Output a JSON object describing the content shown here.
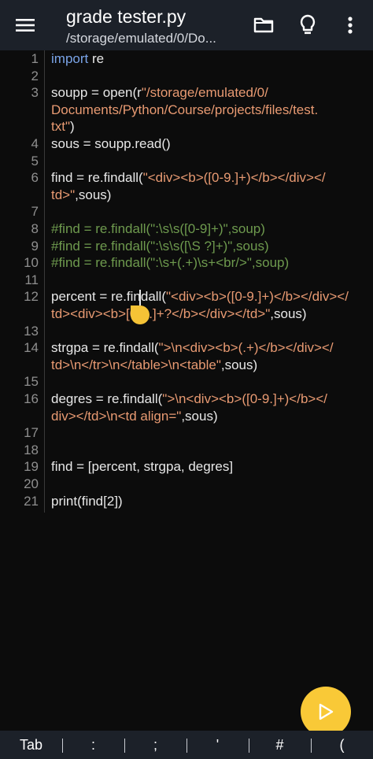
{
  "header": {
    "title": "grade tester.py",
    "path": "/storage/emulated/0/Do..."
  },
  "icons": {
    "menu": "hamburger-menu-icon",
    "folder": "folder-icon",
    "bulb": "lightbulb-icon",
    "more": "more-vert-icon",
    "run": "play-icon"
  },
  "colors": {
    "keyword": "#7aa4e8",
    "string": "#e89a72",
    "comment": "#6e9a4e",
    "accent": "#f9c937",
    "bar": "#1c2129"
  },
  "line_numbers": [
    "1",
    "2",
    "3",
    "4",
    "5",
    "6",
    "7",
    "8",
    "9",
    "10",
    "11",
    "12",
    "13",
    "14",
    "15",
    "16",
    "17",
    "18",
    "19",
    "20",
    "21"
  ],
  "code": {
    "l1_kw": "import",
    "l1_rest": " re",
    "l3_a": "soupp = open(r",
    "l3_b": "\"/storage/emulated/0/",
    "l3w1": "Documents/Python/Course/projects/files/test.",
    "l3w2_s": "txt\"",
    "l3w2_p": ")",
    "l4": "sous = soupp.read()",
    "l6_a": "find = re.findall(",
    "l6_b": "\"<div><b>([0-9.]+)</b></div></",
    "l6w_s": "td>\"",
    "l6w_p": ",sous)",
    "l8": "#find = re.findall(\":\\s\\s([0-9]+)\",soup)",
    "l9": "#find = re.findall(\":\\s\\s([\\S ?]+)\",sous)",
    "l10": "#find = re.findall(\":\\s+(.+)\\s+<br/>\",soup)",
    "l12_a": "percent = re.findall(",
    "l12_b": "\"<div><b>([0-9.]+)</b></div></",
    "l12w_s": "td><div><b>[0-9.]+?</b></div></td>\"",
    "l12w_p": ",sous)",
    "l14_a": "strgpa = re.findall(",
    "l14_b": "\">\\n<div><b>(.+)</b></div></",
    "l14w_s": "td>\\n</tr>\\n</table>\\n<table\"",
    "l14w_p": ",sous)",
    "l16_a": "degres = re.findall(",
    "l16_b": "\">\\n<div><b>([0-9.]+)</b></",
    "l16w_s": "div></td>\\n<td align=\"",
    "l16w_p": ",sous)",
    "l19": "find = [percent, strgpa, degres]",
    "l21": "print(find[2])"
  },
  "symbols": [
    "Tab",
    ":",
    ";",
    "'",
    "#",
    "("
  ]
}
